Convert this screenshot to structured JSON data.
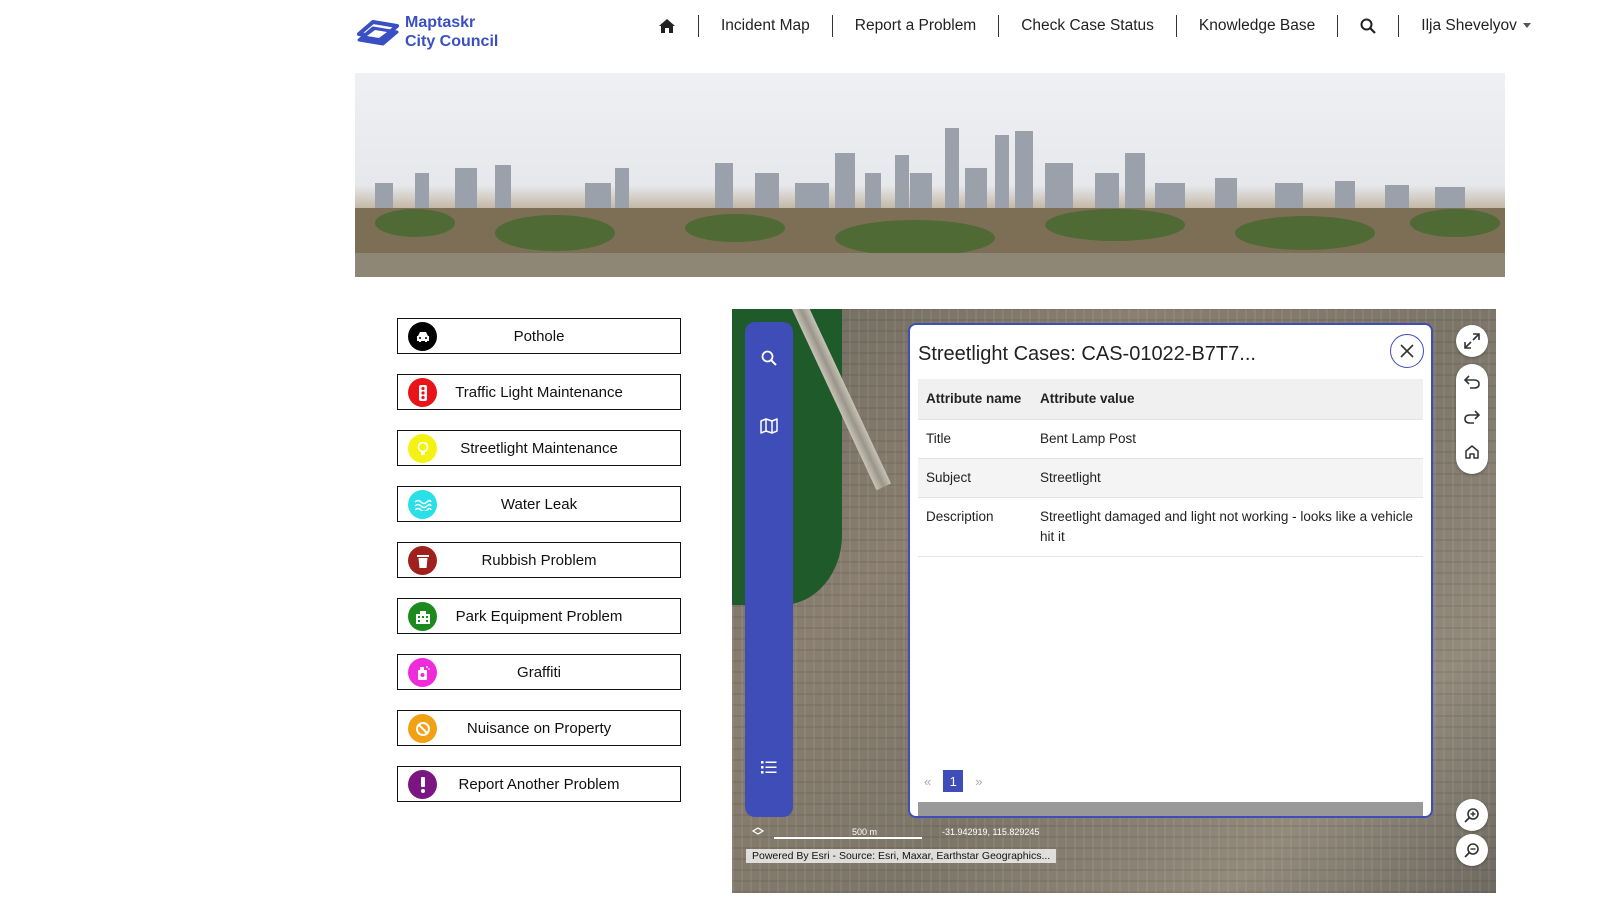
{
  "brand": {
    "line1": "Maptaskr",
    "line2": "City Council",
    "color": "#3a4fc4"
  },
  "nav": {
    "items": [
      "Incident Map",
      "Report a Problem",
      "Check Case Status",
      "Knowledge Base"
    ],
    "user": "Ilja Shevelyov"
  },
  "problems": [
    {
      "label": "Pothole",
      "color": "#000000",
      "icon": "car-icon"
    },
    {
      "label": "Traffic Light Maintenance",
      "color": "#e8141a",
      "icon": "traffic-light-icon"
    },
    {
      "label": "Streetlight Maintenance",
      "color": "#f5f213",
      "icon": "lightbulb-icon"
    },
    {
      "label": "Water Leak",
      "color": "#29e0e8",
      "icon": "water-icon"
    },
    {
      "label": "Rubbish Problem",
      "color": "#a0201e",
      "icon": "trash-icon"
    },
    {
      "label": "Park Equipment Problem",
      "color": "#1d8a1d",
      "icon": "building-icon"
    },
    {
      "label": "Graffiti",
      "color": "#f02bdc",
      "icon": "spray-can-icon"
    },
    {
      "label": "Nuisance on Property",
      "color": "#f0a114",
      "icon": "ban-icon"
    },
    {
      "label": "Report Another Problem",
      "color": "#7a1582",
      "icon": "exclamation-icon"
    }
  ],
  "popup": {
    "title": "Streetlight Cases: CAS-01022-B7T7...",
    "headers": {
      "name": "Attribute name",
      "value": "Attribute value"
    },
    "rows": [
      {
        "name": "Title",
        "value": "Bent Lamp Post"
      },
      {
        "name": "Subject",
        "value": "Streetlight"
      },
      {
        "name": "Description",
        "value": "Streetlight damaged and light not working - looks like a vehicle hit it"
      }
    ],
    "pager": {
      "prev": "«",
      "page": "1",
      "next": "»"
    }
  },
  "map": {
    "scale": "500 m",
    "coords": "-31.942919, 115.829245",
    "attribution": "Powered By Esri - Source: Esri, Maxar, Earthstar Geographics..."
  }
}
